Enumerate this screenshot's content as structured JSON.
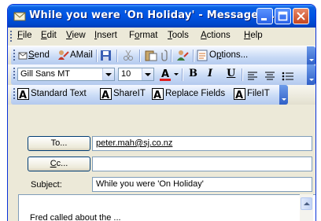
{
  "window": {
    "title": "While you were 'On Holiday' - Message (..."
  },
  "menubar": {
    "items": [
      {
        "pre": "",
        "u": "F",
        "post": "ile"
      },
      {
        "pre": "",
        "u": "E",
        "post": "dit"
      },
      {
        "pre": "",
        "u": "V",
        "post": "iew"
      },
      {
        "pre": "",
        "u": "I",
        "post": "nsert"
      },
      {
        "pre": "F",
        "u": "o",
        "post": "rmat"
      },
      {
        "pre": "",
        "u": "T",
        "post": "ools"
      },
      {
        "pre": "",
        "u": "A",
        "post": "ctions"
      },
      {
        "pre": "",
        "u": "H",
        "post": "elp"
      }
    ]
  },
  "standard_toolbar": {
    "send": {
      "u": "S",
      "post": "end"
    },
    "amail": "AMail",
    "options": {
      "pre": "O",
      "u": "p",
      "post": "tions..."
    }
  },
  "format_toolbar": {
    "font": "Gill Sans MT",
    "size": "10",
    "bold": "B",
    "italic": "I",
    "underline": "U"
  },
  "extension_toolbar": {
    "buttons": [
      "Standard Text",
      "ShareIT",
      "Replace Fields",
      "FileIT"
    ]
  },
  "header": {
    "to_button": {
      "pre": "To",
      "u": "",
      "post": "..."
    },
    "cc_button": {
      "pre": "",
      "u": "C",
      "post": "c..."
    },
    "to_value": "peter.mah@sj.co.nz",
    "cc_value": "",
    "subject_label": "Subject:",
    "subject_value": "While you were 'On Holiday'"
  },
  "body": {
    "text": "Fred called about the ..."
  },
  "colors": {
    "title_bar": "#0055e5",
    "toolbar_blue": "#c9dbf6",
    "close_button": "#c5461f"
  }
}
